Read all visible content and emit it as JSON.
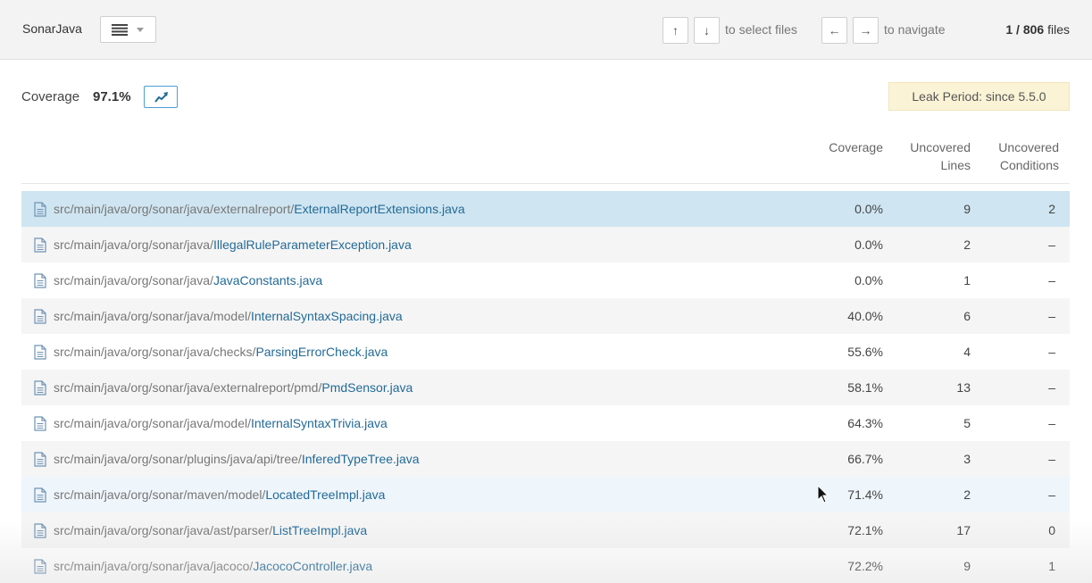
{
  "topbar": {
    "project": "SonarJava",
    "view_icon": "list-icon",
    "keys": {
      "up": "↑",
      "down": "↓",
      "left": "←",
      "right": "→"
    },
    "select_hint": "to select files",
    "navigate_hint": "to navigate",
    "files_position": "1 / 806",
    "files_suffix": "files"
  },
  "summary": {
    "label": "Coverage",
    "value": "97.1%",
    "trend_icon": "trend-chart-icon",
    "leak_period": "Leak Period: since 5.5.0"
  },
  "columns": {
    "coverage": "Coverage",
    "uncovered_lines_1": "Uncovered",
    "uncovered_lines_2": "Lines",
    "uncovered_conditions_1": "Uncovered",
    "uncovered_conditions_2": "Conditions"
  },
  "rows": [
    {
      "dir": "src/main/java/org/sonar/java/externalreport/",
      "file": "ExternalReportExtensions.java",
      "coverage": "0.0%",
      "lines": "9",
      "conditions": "2"
    },
    {
      "dir": "src/main/java/org/sonar/java/",
      "file": "IllegalRuleParameterException.java",
      "coverage": "0.0%",
      "lines": "2",
      "conditions": "–"
    },
    {
      "dir": "src/main/java/org/sonar/java/",
      "file": "JavaConstants.java",
      "coverage": "0.0%",
      "lines": "1",
      "conditions": "–"
    },
    {
      "dir": "src/main/java/org/sonar/java/model/",
      "file": "InternalSyntaxSpacing.java",
      "coverage": "40.0%",
      "lines": "6",
      "conditions": "–"
    },
    {
      "dir": "src/main/java/org/sonar/java/checks/",
      "file": "ParsingErrorCheck.java",
      "coverage": "55.6%",
      "lines": "4",
      "conditions": "–"
    },
    {
      "dir": "src/main/java/org/sonar/java/externalreport/pmd/",
      "file": "PmdSensor.java",
      "coverage": "58.1%",
      "lines": "13",
      "conditions": "–"
    },
    {
      "dir": "src/main/java/org/sonar/java/model/",
      "file": "InternalSyntaxTrivia.java",
      "coverage": "64.3%",
      "lines": "5",
      "conditions": "–"
    },
    {
      "dir": "src/main/java/org/sonar/plugins/java/api/tree/",
      "file": "InferedTypeTree.java",
      "coverage": "66.7%",
      "lines": "3",
      "conditions": "–"
    },
    {
      "dir": "src/main/java/org/sonar/maven/model/",
      "file": "LocatedTreeImpl.java",
      "coverage": "71.4%",
      "lines": "2",
      "conditions": "–"
    },
    {
      "dir": "src/main/java/org/sonar/java/ast/parser/",
      "file": "ListTreeImpl.java",
      "coverage": "72.1%",
      "lines": "17",
      "conditions": "0"
    },
    {
      "dir": "src/main/java/org/sonar/java/jacoco/",
      "file": "JacocoController.java",
      "coverage": "72.2%",
      "lines": "9",
      "conditions": "1"
    }
  ],
  "colors": {
    "link": "#236a97",
    "selected_row": "#cfe5f1",
    "leak_bg": "#fbf3d5",
    "accent": "#4b9fd5"
  }
}
